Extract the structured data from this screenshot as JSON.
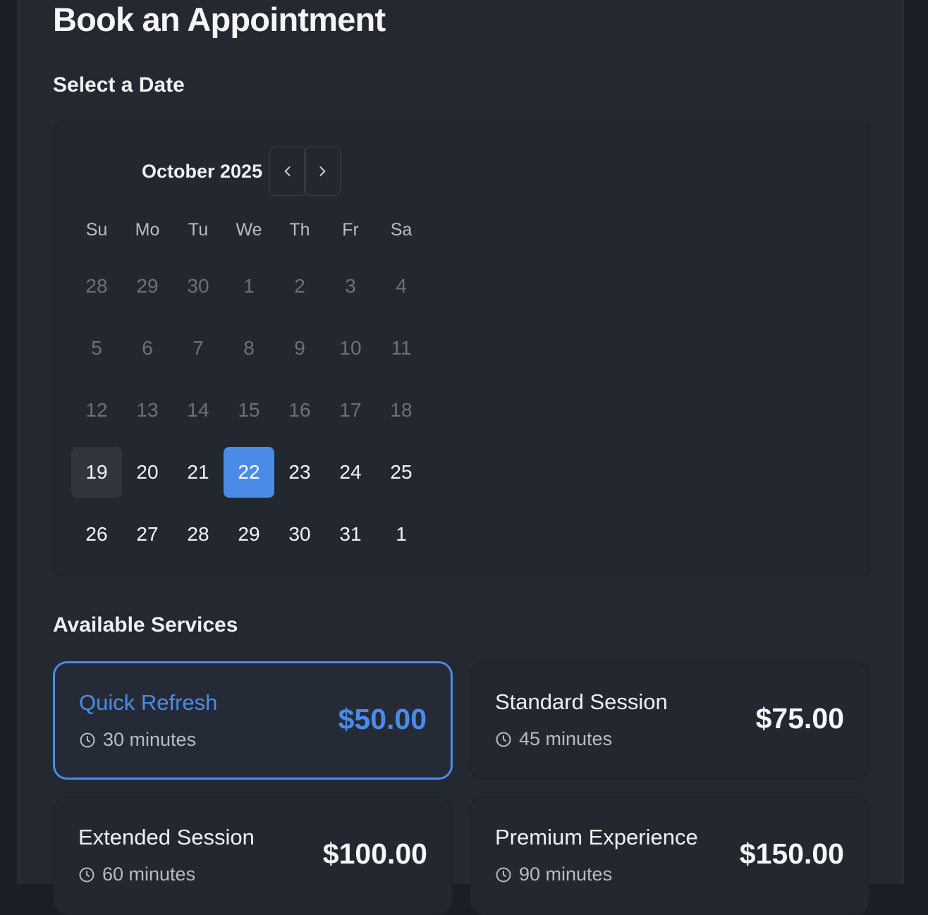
{
  "page": {
    "title": "Book an Appointment"
  },
  "date_section": {
    "title": "Select a Date",
    "month_label": "October 2025",
    "prev_icon": "chevron-left-icon",
    "next_icon": "chevron-right-icon",
    "weekdays": [
      "Su",
      "Mo",
      "Tu",
      "We",
      "Th",
      "Fr",
      "Sa"
    ],
    "weeks": [
      [
        "28",
        "29",
        "30",
        "1",
        "2",
        "3",
        "4"
      ],
      [
        "5",
        "6",
        "7",
        "8",
        "9",
        "10",
        "11"
      ],
      [
        "12",
        "13",
        "14",
        "15",
        "16",
        "17",
        "18"
      ],
      [
        "19",
        "20",
        "21",
        "22",
        "23",
        "24",
        "25"
      ],
      [
        "26",
        "27",
        "28",
        "29",
        "30",
        "31",
        "1"
      ]
    ],
    "disabled_rows": [
      0,
      1,
      2
    ],
    "today": "19",
    "selected": "22"
  },
  "services_section": {
    "title": "Available Services",
    "items": [
      {
        "name": "Quick Refresh",
        "duration": "30 minutes",
        "price": "$50.00",
        "selected": true
      },
      {
        "name": "Standard Session",
        "duration": "45 minutes",
        "price": "$75.00",
        "selected": false
      },
      {
        "name": "Extended Session",
        "duration": "60 minutes",
        "price": "$100.00",
        "selected": false
      },
      {
        "name": "Premium Experience",
        "duration": "90 minutes",
        "price": "$150.00",
        "selected": false
      }
    ]
  },
  "colors": {
    "accent": "#4a8be8",
    "background": "#242830",
    "muted_text": "#6b707a"
  }
}
